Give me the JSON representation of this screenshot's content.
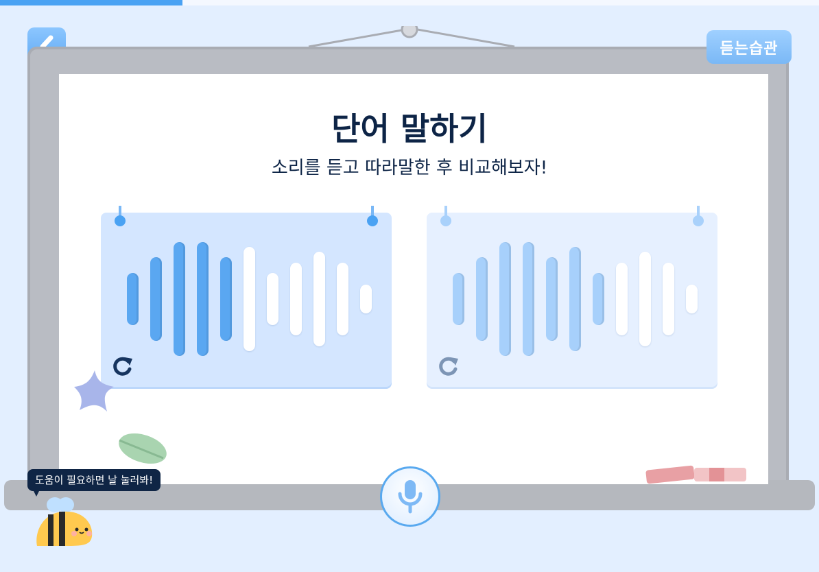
{
  "progress": {
    "fraction": 0.223,
    "color": "#4aa2f3"
  },
  "header": {
    "back_icon": "chevron-left-icon",
    "logo_text": "듣는습관"
  },
  "main": {
    "title": "단어 말하기",
    "subtitle": "소리를 듣고 따라말한 후 비교해보자!"
  },
  "cards": [
    {
      "name": "reference-sound",
      "icon": "replay-icon",
      "played_bars": 5,
      "total_bars": 11
    },
    {
      "name": "my-recording",
      "icon": "replay-icon",
      "played_bars": 7,
      "total_bars": 11
    }
  ],
  "mic": {
    "icon": "microphone-icon",
    "color": "#59a9ef"
  },
  "helper": {
    "text": "도움이 필요하면 날 눌러봐!",
    "icon": "bee-icon"
  },
  "colors": {
    "accent": "#4aa2f3",
    "title": "#0d2446",
    "board": "#ffffff",
    "background": "#e3efff"
  }
}
